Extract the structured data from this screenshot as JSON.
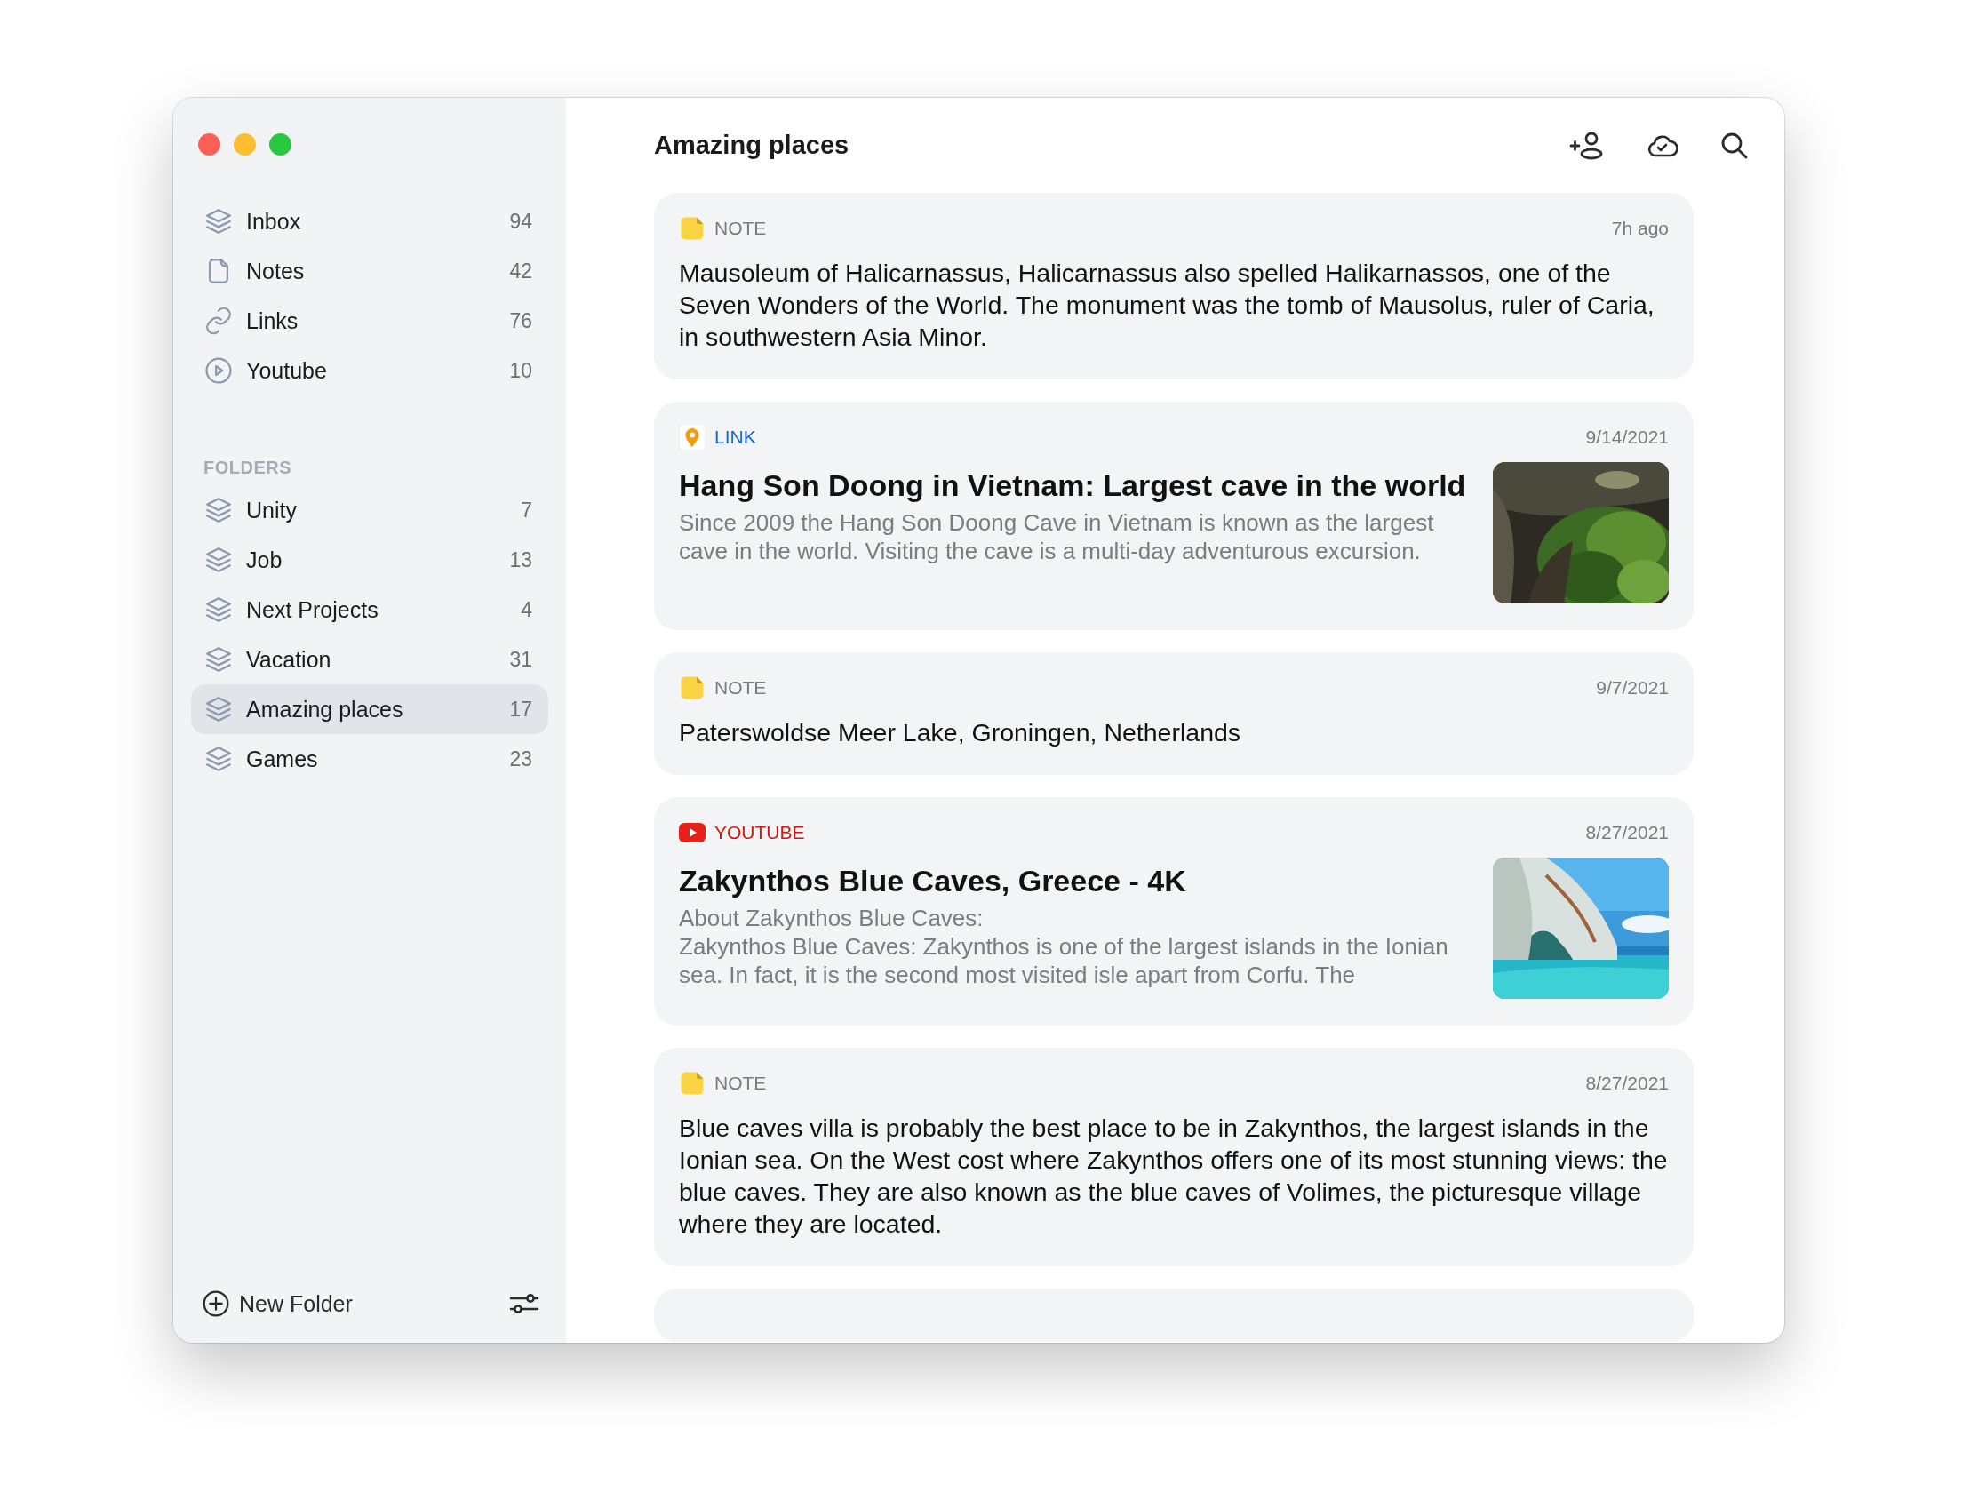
{
  "sidebar": {
    "items": [
      {
        "kind": "inbox",
        "label": "Inbox",
        "count": "94",
        "selected": false
      },
      {
        "kind": "notes",
        "label": "Notes",
        "count": "42",
        "selected": false
      },
      {
        "kind": "links",
        "label": "Links",
        "count": "76",
        "selected": false
      },
      {
        "kind": "youtube",
        "label": "Youtube",
        "count": "10",
        "selected": false
      }
    ],
    "folders_heading": "FOLDERS",
    "folders": [
      {
        "label": "Unity",
        "count": "7",
        "selected": false
      },
      {
        "label": "Job",
        "count": "13",
        "selected": false
      },
      {
        "label": "Next Projects",
        "count": "4",
        "selected": false
      },
      {
        "label": "Vacation",
        "count": "31",
        "selected": false
      },
      {
        "label": "Amazing places",
        "count": "17",
        "selected": true
      },
      {
        "label": "Games",
        "count": "23",
        "selected": false
      }
    ],
    "new_folder": "New Folder"
  },
  "header": {
    "title": "Amazing places"
  },
  "cards": [
    {
      "kind": "note",
      "label": "NOTE",
      "time": "7h ago",
      "text": "Mausoleum of Halicarnassus, Halicarnassus also spelled Halikarnassos, one of the Seven Wonders of the World. The monument was the tomb of Mausolus, ruler of Caria, in southwestern Asia Minor."
    },
    {
      "kind": "link",
      "label": "LINK",
      "time": "9/14/2021",
      "title": "Hang Son Doong in Vietnam: Largest cave in the world",
      "description": [
        "Since 2009 the Hang Son Doong Cave in Vietnam is known as the largest cave in the world. Visiting the cave is a multi-day adventurous excursion."
      ],
      "picture": {
        "kind": "picture"
      }
    },
    {
      "kind": "note",
      "label": "NOTE",
      "time": "9/7/2021",
      "text": "Paterswoldse Meer Lake, Groningen, Netherlands"
    },
    {
      "kind": "youtube",
      "label": "YOUTUBE",
      "time": "8/27/2021",
      "title": "Zakynthos Blue Caves, Greece - 4K",
      "description": [
        "About Zakynthos Blue Caves:",
        "Zakynthos Blue Caves: Zakynthos is one of the largest islands in the Ionian sea. In fact, it is the second most visited isle apart from Corfu. The"
      ],
      "picture": {
        "kind": "picture"
      }
    },
    {
      "kind": "note",
      "label": "NOTE",
      "time": "8/27/2021",
      "text": "Blue caves villa is probably the best place to be in Zakynthos, the largest islands in the Ionian sea. On the West cost where Zakynthos offers one of its most stunning views: the blue caves. They are also known as the blue caves of Volimes, the picturesque village where they are located."
    }
  ]
}
